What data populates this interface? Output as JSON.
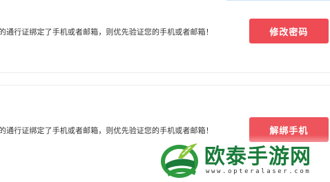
{
  "section1": {
    "message": "的通行证绑定了手机或者邮箱，则优先验证您的手机或者邮箱！",
    "button_label": "修改密码"
  },
  "section2": {
    "message": "的通行证绑定了手机或者邮箱，则优先验证您的手机或者邮箱！",
    "button_label": "解绑手机"
  },
  "watermark": {
    "brand": "欧泰手游网",
    "url": "www.opteralaser.com"
  },
  "colors": {
    "button": "#ee4b54",
    "brand_green": "#1a7b3a"
  }
}
